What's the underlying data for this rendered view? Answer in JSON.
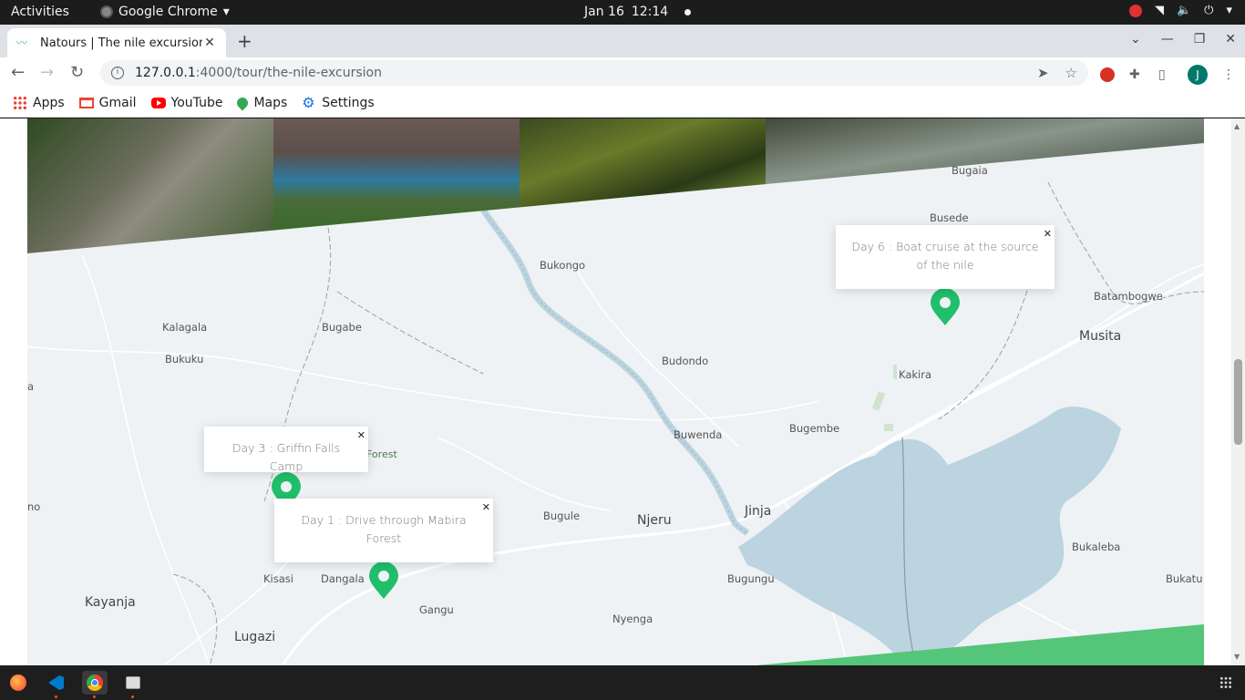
{
  "topbar": {
    "activities": "Activities",
    "app_name": "Google Chrome",
    "date": "Jan 16",
    "time": "12:14"
  },
  "browser": {
    "tab_title": "Natours | The nile excursion",
    "url_host": "127.0.0.1",
    "url_path": ":4000/tour/the-nile-excursion",
    "profile_initial": "J",
    "bookmarks": [
      {
        "label": "Apps",
        "icon": "apps-icon"
      },
      {
        "label": "Gmail",
        "icon": "gmail-icon"
      },
      {
        "label": "YouTube",
        "icon": "youtube-icon"
      },
      {
        "label": "Maps",
        "icon": "maps-icon"
      },
      {
        "label": "Settings",
        "icon": "gear-icon"
      }
    ]
  },
  "map": {
    "popups": [
      {
        "text": "Day 6 : Boat cruise at the source of the nile"
      },
      {
        "text": "Day 3 : Griffin Falls Camp"
      },
      {
        "text": "Day 1 : Drive through Mabira Forest"
      }
    ],
    "places": {
      "bugaia": "Bugaia",
      "busede": "Busede",
      "batambogwe": "Batambogwe",
      "musita": "Musita",
      "kakira": "Kakira",
      "bukongo": "Bukongo",
      "kalagala": "Kalagala",
      "bugabe": "Bugabe",
      "bukuku": "Bukuku",
      "budondo": "Budondo",
      "buwenda": "Buwenda",
      "bugembe": "Bugembe",
      "forest": "Forest",
      "bugule": "Bugule",
      "njeru": "Njeru",
      "jinja": "Jinja",
      "bukaleba": "Bukaleba",
      "kisasi": "Kisasi",
      "dangala": "Dangala",
      "bugungu": "Bugungu",
      "bukatu": "Bukatu",
      "kayanja": "Kayanja",
      "gangu": "Gangu",
      "nyenga": "Nyenga",
      "lugazi": "Lugazi",
      "edge_a": "a",
      "edge_no": "no"
    },
    "colors": {
      "land": "#eef2f4",
      "water": "#bcd3e0",
      "pin": "#20bf6b",
      "accent": "#55c57a"
    }
  }
}
